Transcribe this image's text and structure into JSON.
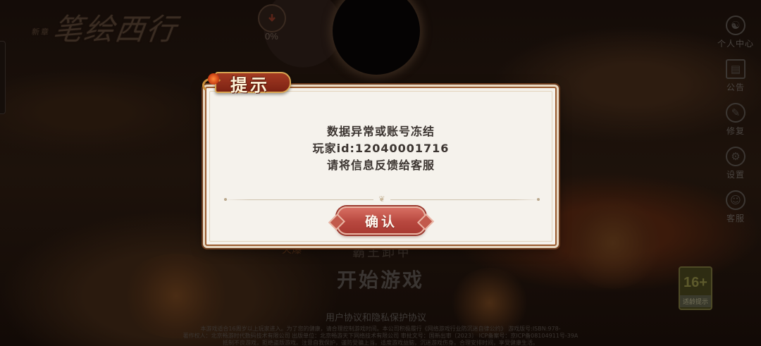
{
  "background": {
    "game_logo_small": "新章",
    "game_logo": "笔绘西行",
    "progress_text": "0%",
    "server_tag": "火爆",
    "server_name": "霸王卸甲",
    "start_button": "开始游戏",
    "agreement": "用户协议和隐私保护协议",
    "footer_line1": "本游戏适合16周岁以上玩家进入。为了您的健康，请合理控制游戏时间。本公司积极履行《网络游戏行业防沉迷自律公约》 游戏版号:ISBN:978-",
    "footer_line2": "著作权人：北京畅游时代数码技术有限公司  出版单位：北京畅游天下网络技术有限公司  审批文号：国新出审〔2023〕  ICP备案号：京ICP备08104911号-39A",
    "footer_line3": "抵制不良游戏，拒绝盗版游戏。注意自我保护，谨防受骗上当。适度游戏益脑，沉迷游戏伤身。合理安排时间，享受健康生活。",
    "age_badge_number": "16+",
    "age_badge_label": "适龄提示"
  },
  "sidebar": {
    "items": [
      {
        "label": "个人中心",
        "icon": "user-center-icon"
      },
      {
        "label": "公告",
        "icon": "notice-icon"
      },
      {
        "label": "修复",
        "icon": "repair-icon"
      },
      {
        "label": "设置",
        "icon": "gear-icon"
      },
      {
        "label": "客服",
        "icon": "service-icon"
      }
    ]
  },
  "dialog": {
    "title": "提示",
    "message_line1": "数据异常或账号冻结",
    "message_line2": "玩家id:12040001716",
    "message_line3": "请将信息反馈给客服",
    "confirm_label": "确认"
  },
  "colors": {
    "dialog_background": "#f5f2ec",
    "dialog_border": "#9a5a2e",
    "confirm_button": "#b8483f",
    "title_ribbon": "#a33a22"
  }
}
